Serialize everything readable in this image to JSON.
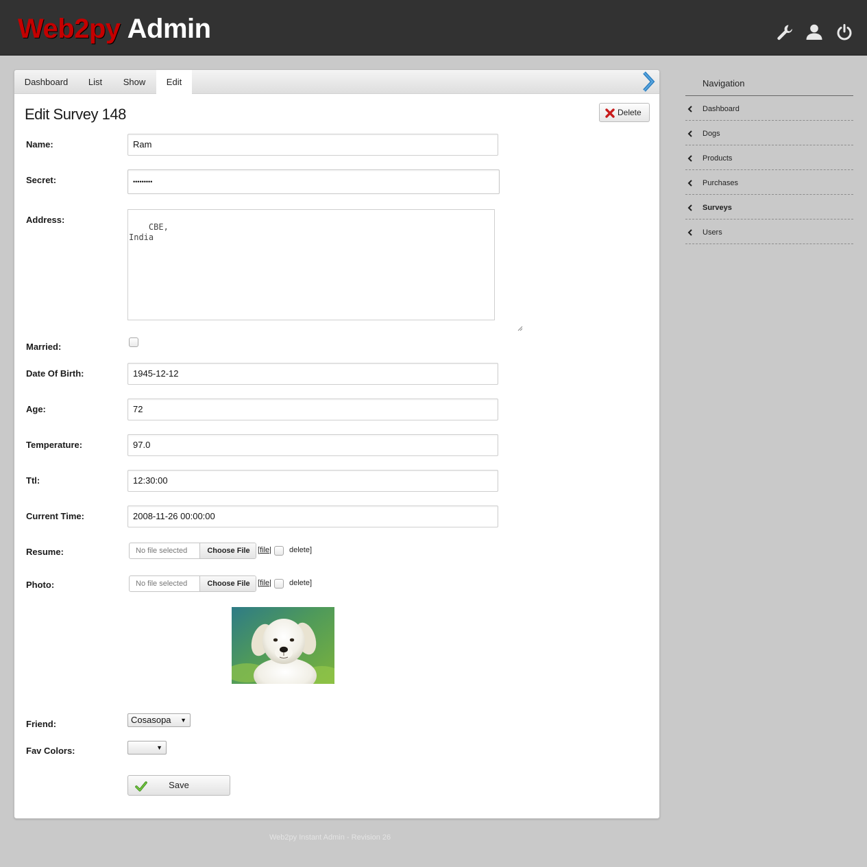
{
  "header": {
    "brand": "Web2py",
    "title": "Admin",
    "icons": [
      "wrench-icon",
      "user-icon",
      "power-icon"
    ],
    "colors": {
      "bar": "#323232",
      "brand": "#c40000"
    }
  },
  "tabs": [
    {
      "label": "Dashboard",
      "active": false
    },
    {
      "label": "List",
      "active": false
    },
    {
      "label": "Show",
      "active": false
    },
    {
      "label": "Edit",
      "active": true
    }
  ],
  "page": {
    "title": "Edit Survey 148",
    "delete_label": "Delete"
  },
  "form": {
    "name": {
      "label": "Name:",
      "value": "Ram"
    },
    "secret": {
      "label": "Secret:",
      "value": "•••••••••"
    },
    "address": {
      "label": "Address:",
      "value": "CBE,\nIndia"
    },
    "married": {
      "label": "Married:",
      "checked": false
    },
    "dob": {
      "label": "Date Of Birth:",
      "value": "1945-12-12"
    },
    "age": {
      "label": "Age:",
      "value": "72"
    },
    "temperature": {
      "label": "Temperature:",
      "value": "97.0"
    },
    "ttl": {
      "label": "Ttl:",
      "value": "12:30:00"
    },
    "current_time": {
      "label": "Current Time:",
      "value": "2008-11-26 00:00:00"
    },
    "resume": {
      "label": "Resume:",
      "status": "No file selected",
      "button": "Choose File",
      "open_bracket": "[",
      "link": "file",
      "separator": "|",
      "delete": "delete]"
    },
    "photo": {
      "label": "Photo:",
      "status": "No file selected",
      "button": "Choose File",
      "open_bracket": "[",
      "link": "file",
      "separator": "|",
      "delete": "delete]"
    },
    "friend": {
      "label": "Friend:",
      "value": "Cosasopa"
    },
    "fav_colors": {
      "label": "Fav Colors:",
      "value": ""
    },
    "save_label": "Save"
  },
  "sidebar": {
    "title": "Navigation",
    "items": [
      {
        "label": "Dashboard",
        "active": false
      },
      {
        "label": "Dogs",
        "active": false
      },
      {
        "label": "Products",
        "active": false
      },
      {
        "label": "Purchases",
        "active": false
      },
      {
        "label": "Surveys",
        "active": true
      },
      {
        "label": "Users",
        "active": false
      }
    ]
  },
  "footer": {
    "text": "Web2py Instant Admin - Revision 26"
  }
}
